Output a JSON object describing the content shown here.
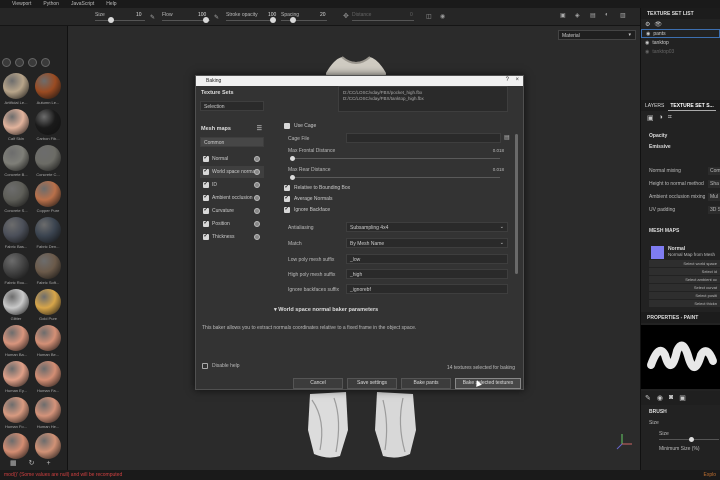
{
  "menubar": [
    "Viewport",
    "Python",
    "JavaScript",
    "Help"
  ],
  "toolbar": {
    "size_label": "Size",
    "size_value": "10",
    "flow_label": "Flow",
    "flow_value": "100",
    "stroke_label": "Stroke opacity",
    "stroke_value": "100",
    "spacing_label": "Spacing",
    "spacing_value": "20",
    "distance_label": "Distance",
    "distance_value": "0"
  },
  "shelf": {
    "materials": [
      {
        "name": "Artificial Le...",
        "color": "#b8a58a"
      },
      {
        "name": "Autumn Le...",
        "color": "#9a4b22"
      },
      {
        "name": "Calf Skin",
        "color": "#e2b39c"
      },
      {
        "name": "Carbon Fib...",
        "color": "#1a1a1a"
      },
      {
        "name": "Concrete B...",
        "color": "#7f7f78"
      },
      {
        "name": "Concrete C...",
        "color": "#6c6c66"
      },
      {
        "name": "Concrete S...",
        "color": "#5e5e58"
      },
      {
        "name": "Copper Pure",
        "color": "#b9704a"
      },
      {
        "name": "Fabric Bas...",
        "color": "#4b4f59"
      },
      {
        "name": "Fabric Den...",
        "color": "#3b4450"
      },
      {
        "name": "Fabric Rou...",
        "color": "#444444"
      },
      {
        "name": "Fabric Soft...",
        "color": "#6b5a4a"
      },
      {
        "name": "Glitter",
        "color": "#c9c9c9"
      },
      {
        "name": "Gold Pure",
        "color": "#d8a64a"
      },
      {
        "name": "Human Ba...",
        "color": "#d9957d"
      },
      {
        "name": "Human Be...",
        "color": "#d49076"
      },
      {
        "name": "Human Ey...",
        "color": "#e0a088"
      },
      {
        "name": "Human Fa...",
        "color": "#d38e74"
      },
      {
        "name": "Human Fo...",
        "color": "#d89a80"
      },
      {
        "name": "Human He...",
        "color": "#d4937a"
      },
      {
        "name": "",
        "color": "#d48d72"
      },
      {
        "name": "",
        "color": "#d19276"
      }
    ]
  },
  "viewport": {
    "shading_select": "Material"
  },
  "right_panel": {
    "texture_set_list_title": "TEXTURE SET LIST",
    "texture_sets": [
      {
        "name": "pants",
        "state": "selected"
      },
      {
        "name": "tanktop",
        "state": "normal"
      },
      {
        "name": "tanktop03",
        "state": "dim"
      }
    ],
    "tabs": [
      "LAYERS",
      "TEXTURE SET S..."
    ],
    "opacity_label": "Opacity",
    "emissive_label": "Emissive",
    "params": [
      {
        "label": "Normal mixing",
        "value": "Com"
      },
      {
        "label": "Height to normal method",
        "value": "Sha"
      },
      {
        "label": "Ambient occlusion mixing",
        "value": "Mul"
      },
      {
        "label": "UV padding",
        "value": "3D S"
      }
    ],
    "mesh_maps_title": "MESH MAPS",
    "normal_map_title": "Normal",
    "normal_map_desc": "Normal Map from Mesh",
    "select_buttons": [
      "Select world space",
      "Select id",
      "Select ambient oc",
      "Select curvat",
      "Select positi",
      "Select thickn"
    ],
    "properties_title": "PROPERTIES - PAINT",
    "brush_title": "BRUSH",
    "size_label": "Size",
    "size_sub": "Size",
    "min_size_label": "Minimum Size (%)"
  },
  "status": {
    "error": "mod()' (Some values are null) and will be recomputed",
    "right": "Explo"
  },
  "dialog": {
    "title": "Baking",
    "help": "?",
    "close": "×",
    "texture_sets_head": "Texture Sets",
    "selection": "Selection",
    "mesh_maps_head": "Mesh maps",
    "common": "Common",
    "maps": [
      {
        "label": "Normal",
        "checked": true
      },
      {
        "label": "World space normal",
        "checked": true,
        "selected": true
      },
      {
        "label": "ID",
        "checked": true
      },
      {
        "label": "Ambient occlusion",
        "checked": true
      },
      {
        "label": "Curvature",
        "checked": true
      },
      {
        "label": "Position",
        "checked": true
      },
      {
        "label": "Thickness",
        "checked": true
      }
    ],
    "paths": [
      "D:/CC/LOSC/vday/FBX/pocket_high.fbx",
      "D:/CC/LOSC/vday/FBX/tanktop_high.fbx"
    ],
    "use_cage": "Use Cage",
    "cage_file": "Cage File",
    "max_frontal": "Max Frontal Distance",
    "max_frontal_val": "0.018",
    "max_rear": "Max Rear Distance",
    "max_rear_val": "0.018",
    "relative_bbox": "Relative to Bounding Box",
    "average_normals": "Average Normals",
    "ignore_backface": "Ignore Backface",
    "antialiasing_label": "Antialiasing",
    "antialiasing_value": "Subsampling 4x4",
    "match_label": "Match",
    "match_value": "By Mesh Name",
    "low_suffix_label": "Low poly mesh suffix",
    "low_suffix_value": "_low",
    "high_suffix_label": "High poly mesh suffix",
    "high_suffix_value": "_high",
    "ignore_suffix_label": "Ignore backfaces suffix",
    "ignore_suffix_value": "_ignorebf",
    "section_title": "World space normal baker parameters",
    "description": "This baker allows you to extract normals coordinates relative to a fixed frame in the object space.",
    "disable_help": "Disable help",
    "count": "14 textures selected for baking",
    "buttons": [
      "Cancel",
      "Save settings",
      "Bake pants",
      "Bake selected textures"
    ]
  }
}
